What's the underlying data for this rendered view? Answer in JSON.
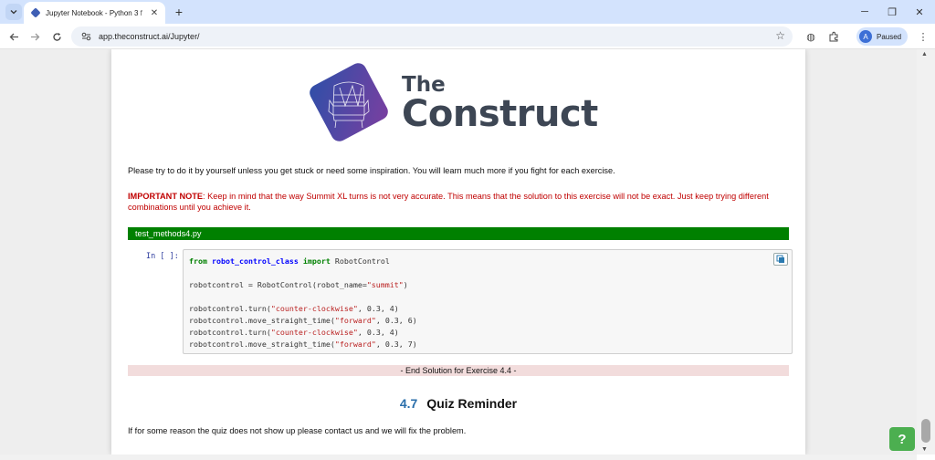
{
  "browser": {
    "tab_title": "Jupyter Notebook - Python 3 f",
    "url": "app.theconstruct.ai/Jupyter/",
    "profile_initial": "A",
    "profile_status": "Paused"
  },
  "logo": {
    "line1": "The",
    "line2": "Construct",
    "colors": {
      "tile_start": "#2f4fa8",
      "tile_end": "#7a3fa0",
      "text": "#3d4654"
    }
  },
  "notebook": {
    "intro": "Please try to do it by yourself unless you get stuck or need some inspiration. You will learn much more if you fight for each exercise.",
    "important_label": "IMPORTANT NOTE",
    "important_text": ": Keep in mind that the way Summit XL turns is not very accurate. This means that the solution to this exercise will not be exact. Just keep trying different combinations until you achieve it.",
    "file_bar": "test_methods4.py",
    "prompt": "In [ ]:",
    "code": {
      "l1_from": "from",
      "l1_module": "robot_control_class",
      "l1_import": "import",
      "l1_name": " RobotControl",
      "l3": "robotcontrol = RobotControl(robot_name=",
      "l3_str": "\"summit\"",
      "l3_end": ")",
      "l5_call": "robotcontrol.turn(",
      "l5_str": "\"counter-clockwise\"",
      "l5_args": ", 0.3, 4)",
      "l6_call": "robotcontrol.move_straight_time(",
      "l6_str": "\"forward\"",
      "l6_args": ", 0.3, 6)",
      "l7_call": "robotcontrol.turn(",
      "l7_str": "\"counter-clockwise\"",
      "l7_args": ", 0.3, 4)",
      "l8_call": "robotcontrol.move_straight_time(",
      "l8_str": "\"forward\"",
      "l8_args": ", 0.3, 7)"
    },
    "end_solution": "- End Solution for Exercise 4.4 -",
    "section_number": "4.7",
    "section_title": "Quiz Reminder",
    "quiz_note": "If for some reason the quiz does not show up please contact us and we will fix the problem."
  },
  "help_button": "?",
  "colors": {
    "accent_green": "#008000",
    "important_red": "#c00000",
    "heading_blue": "#296eaa",
    "help_green": "#4caf50"
  }
}
